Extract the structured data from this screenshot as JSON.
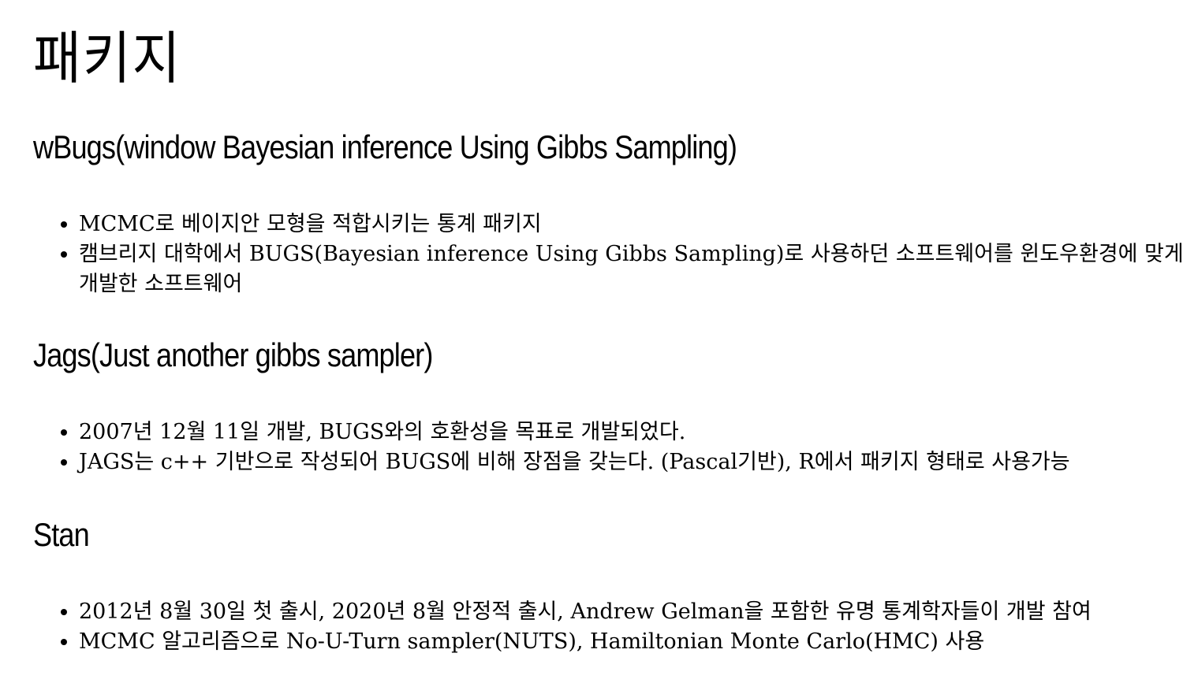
{
  "page": {
    "title": "패키지"
  },
  "sections": [
    {
      "heading": "wBugs(window Bayesian inference Using Gibbs Sampling)",
      "items": [
        "MCMC로 베이지안 모형을 적합시키는 통계 패키지",
        "캠브리지 대학에서 BUGS(Bayesian inference Using Gibbs Sampling)로 사용하던 소프트웨어를 윈도우환경에 맞게 개발한 소프트웨어"
      ]
    },
    {
      "heading": "Jags(Just another gibbs sampler)",
      "items": [
        "2007년 12월 11일 개발, BUGS와의 호환성을 목표로 개발되었다.",
        "JAGS는 c++ 기반으로 작성되어 BUGS에 비해 장점을 갖는다. (Pascal기반), R에서 패키지 형태로 사용가능"
      ]
    },
    {
      "heading": "Stan",
      "items": [
        "2012년 8월 30일 첫 출시, 2020년 8월 안정적 출시, Andrew Gelman을 포함한 유명 통계학자들이 개발 참여",
        "MCMC 알고리즘으로 No-U-Turn sampler(NUTS), Hamiltonian Monte Carlo(HMC) 사용"
      ]
    }
  ]
}
